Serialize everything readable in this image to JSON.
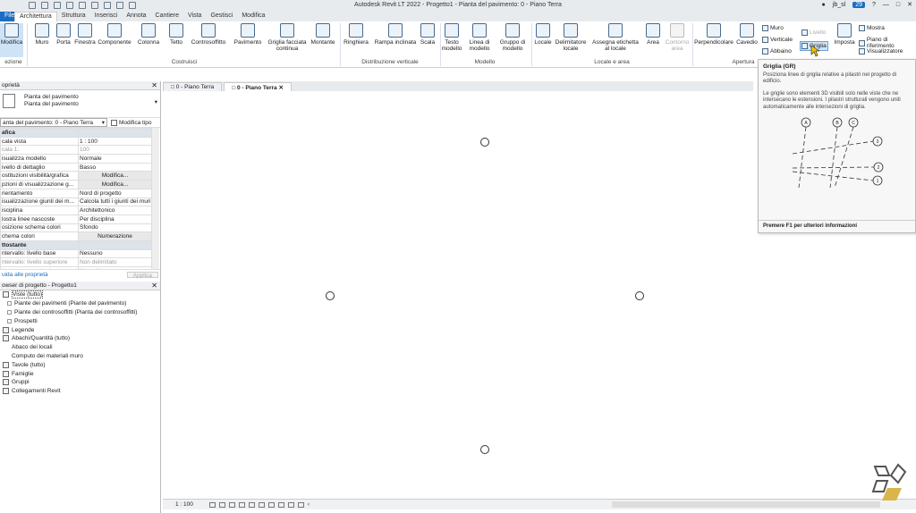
{
  "title": "Autodesk Revit LT 2022 - Progetto1 - Pianta del pavimento: 0 - Piano Terra",
  "user": "jb_sl",
  "notification_count": "29",
  "tabs": [
    "File",
    "Architettura",
    "Struttura",
    "Inserisci",
    "Annota",
    "Cantiere",
    "Vista",
    "Gestisci",
    "Modifica"
  ],
  "ribbon": {
    "modify": "Modifica",
    "selection": "ezione",
    "buttons": [
      "Muro",
      "Porta",
      "Finestra",
      "Componente",
      "Colonna",
      "Tetto",
      "Controsoffitto",
      "Pavimento",
      "Griglia facciata continua",
      "Montante",
      "Ringhiera",
      "Rampa inclinata",
      "Scala",
      "Testo modello",
      "Linea di modello",
      "Gruppo di modello",
      "Locale",
      "Delimitatore locale",
      "Assegna etichetta al locale",
      "Area",
      "Contorno area",
      "Perpendicolare",
      "Cavedio"
    ],
    "groups": [
      "Costruisci",
      "Distribuzione verticale",
      "Modello",
      "Locale e area",
      "Apertura"
    ],
    "right_small": [
      "Muro",
      "Verticale",
      "Abbaino",
      "Livello",
      "Griglia",
      "Imposta",
      "Mostra",
      "Piano di riferimento",
      "Visualizzatore"
    ]
  },
  "properties": {
    "header": "oprietà",
    "type_line1": "Pianta del pavimento",
    "type_line2": "Pianta del pavimento",
    "selector": "anta del pavimento: 0 - Piano Terra",
    "edit_type": "Modifica tipo",
    "rows": [
      {
        "k": "afica",
        "v": "",
        "group": true
      },
      {
        "k": "cala vista",
        "v": "1 : 100"
      },
      {
        "k": "cala  1:",
        "v": "100",
        "dim": true
      },
      {
        "k": "isualizza modello",
        "v": "Normale"
      },
      {
        "k": "ivello di dettaglio",
        "v": "Basso"
      },
      {
        "k": "ostituzioni visibilità/grafica",
        "v": "Modifica...",
        "btn": true
      },
      {
        "k": "pzioni di visualizzazione g...",
        "v": "Modifica...",
        "btn": true
      },
      {
        "k": "rientamento",
        "v": "Nord di progetto"
      },
      {
        "k": "isualizzazione giunti dei m...",
        "v": "Calcola tutti i giunti dei muri"
      },
      {
        "k": "isciplina",
        "v": "Architettonico"
      },
      {
        "k": "lostra linee nascoste",
        "v": "Per disciplina"
      },
      {
        "k": "osizione schema colori",
        "v": "Sfondo"
      },
      {
        "k": "chema colori",
        "v": "Numerazione",
        "btn": true
      },
      {
        "k": "ttostante",
        "v": "",
        "group": true
      },
      {
        "k": "ntervallo: livello base",
        "v": "Nessuno"
      },
      {
        "k": "ntervallo: livello superiore",
        "v": "Non delimitato",
        "dim": true
      },
      {
        "k": "rientamento sottostante",
        "v": "Verso il basso",
        "dim": true
      }
    ],
    "help": "uida alle proprietà",
    "apply": "Applica"
  },
  "browser": {
    "header": "owser di progetto - Progetto1",
    "items": [
      {
        "label": "Viste (tutto)",
        "level": 0,
        "sel": true
      },
      {
        "label": "Piante dei pavimenti (Piante del pavimento)",
        "level": 1
      },
      {
        "label": "Piante dei controsoffitti (Pianta dei controsoffitti)",
        "level": 1
      },
      {
        "label": "Prospetti",
        "level": 1
      },
      {
        "label": "Legende",
        "level": 0
      },
      {
        "label": "Abachi/Quantità (tutto)",
        "level": 0
      },
      {
        "label": "Abaco dei locali",
        "level": 2
      },
      {
        "label": "Computo dei materiali muro",
        "level": 2
      },
      {
        "label": "Tavole (tutto)",
        "level": 0
      },
      {
        "label": "Famiglie",
        "level": 0
      },
      {
        "label": "Gruppi",
        "level": 0
      },
      {
        "label": "Collegamenti Revit",
        "level": 0
      }
    ]
  },
  "view_tabs": [
    "0 - Piano Terra",
    "0 - Piano Terra"
  ],
  "status_scale": "1 : 100",
  "tooltip": {
    "title": "Griglia (GR)",
    "p1": "Posiziona linee di griglia relative a pilastri nel progetto di edificio.",
    "p2": "Le griglie sono elementi 3D visibili solo nelle viste che ne intersecano le estensioni. I pilastri strutturali vengono uniti automaticamente alle intersezioni di griglia.",
    "labels": [
      "A",
      "B",
      "C",
      "3",
      "2",
      "1"
    ],
    "footer": "Premere F1 per ulteriori informazioni"
  },
  "colors": {
    "file_tab": "#1a6dc2",
    "accent": "#1a6dc2"
  }
}
